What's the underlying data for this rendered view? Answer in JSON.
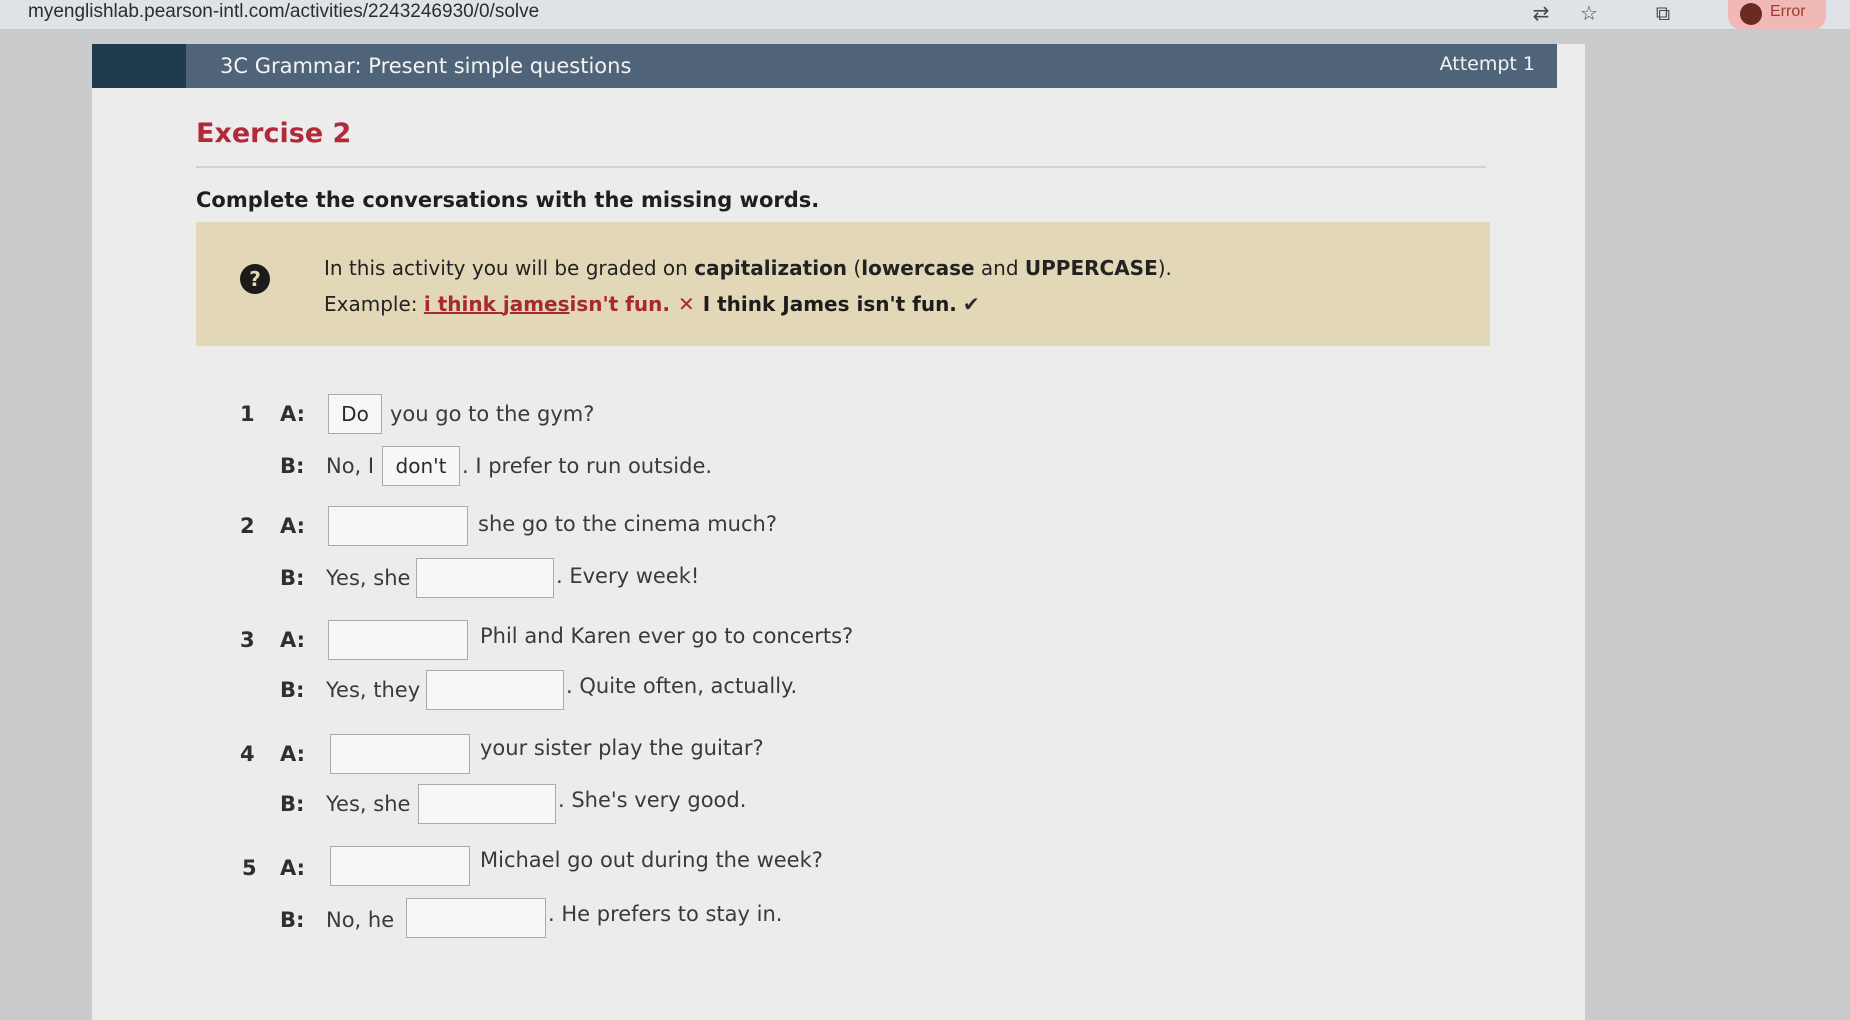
{
  "browser": {
    "url": "myenglishlab.pearson-intl.com/activities/2243246930/0/solve",
    "error_label": "Error"
  },
  "header": {
    "title": "3C Grammar: Present simple questions",
    "attempt": "Attempt 1"
  },
  "exercise": {
    "title": "Exercise 2",
    "instructions": "Complete the conversations with the missing words.",
    "info": {
      "line1_prefix": "In this activity you will be graded on ",
      "line1_bold1": "capitalization",
      "line1_mid": " (",
      "line1_bold2": "lowercase",
      "line1_and": " and ",
      "line1_bold3": "UPPERCASE",
      "line1_suffix": ").",
      "example_label": "Example: ",
      "example_wrong_i": "i",
      "example_wrong_mid": " think ",
      "example_wrong_james": "james",
      "example_wrong_end": " isn't fun.",
      "cross": "✕",
      "example_right": "I think James isn't fun.",
      "check": "✔"
    }
  },
  "questions": [
    {
      "number": "1",
      "a_label": "A:",
      "a_value": "Do",
      "a_text": "you go to the gym?",
      "b_label": "B:",
      "b_before": "No, I",
      "b_value": "don't",
      "b_after": ". I prefer to run outside."
    },
    {
      "number": "2",
      "a_label": "A:",
      "a_value": "",
      "a_text": "she go to the cinema much?",
      "b_label": "B:",
      "b_before": "Yes, she",
      "b_value": "",
      "b_after": ". Every week!"
    },
    {
      "number": "3",
      "a_label": "A:",
      "a_value": "",
      "a_text": "Phil and Karen ever go to concerts?",
      "b_label": "B:",
      "b_before": "Yes, they",
      "b_value": "",
      "b_after": ". Quite often, actually."
    },
    {
      "number": "4",
      "a_label": "A:",
      "a_value": "",
      "a_text": "your sister play the guitar?",
      "b_label": "B:",
      "b_before": "Yes, she",
      "b_value": "",
      "b_after": ". She's very good."
    },
    {
      "number": "5",
      "a_label": "A:",
      "a_value": "",
      "a_text": "Michael go out during the week?",
      "b_label": "B:",
      "b_before": "No, he",
      "b_value": "",
      "b_after": ". He prefers to stay in."
    }
  ]
}
